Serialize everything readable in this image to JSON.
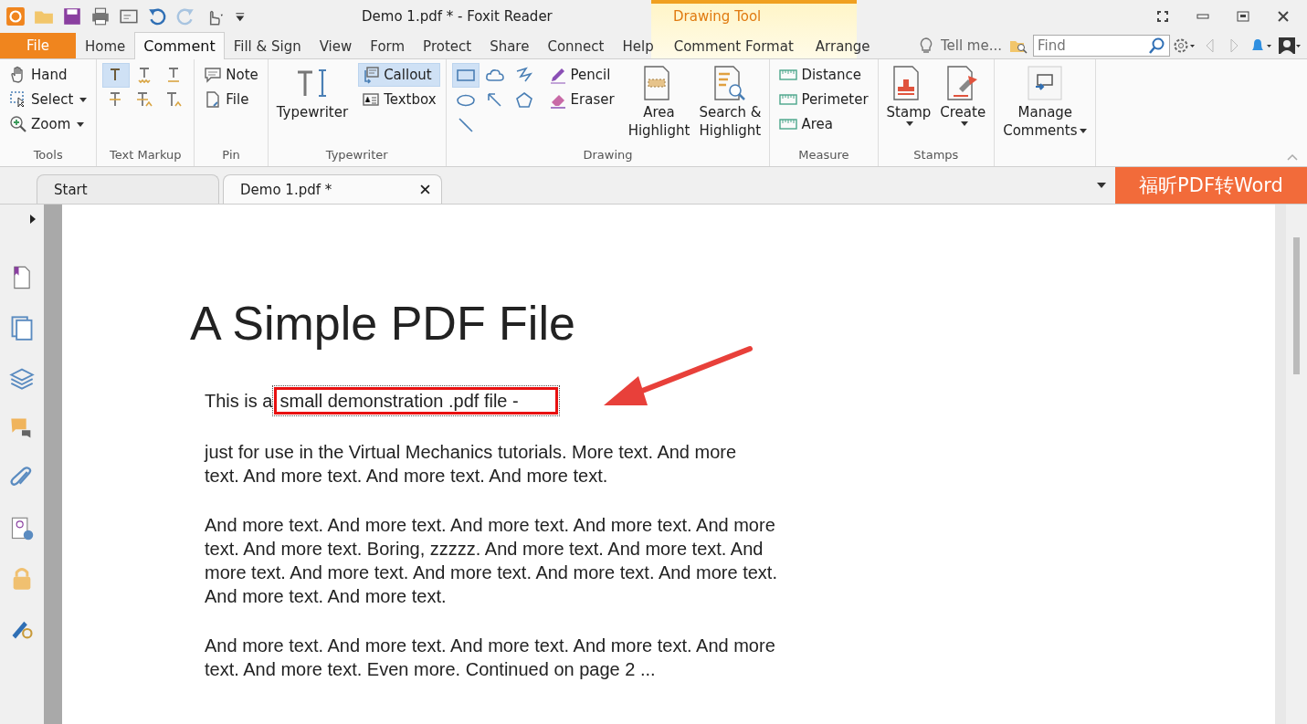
{
  "window": {
    "title": "Demo 1.pdf * - Foxit Reader",
    "context_tab": "Drawing Tool"
  },
  "menu_tabs": [
    {
      "label": "File",
      "kind": "file",
      "selected": false
    },
    {
      "label": "Home",
      "kind": "tab",
      "selected": false
    },
    {
      "label": "Comment",
      "kind": "tab",
      "selected": true
    },
    {
      "label": "Fill & Sign",
      "kind": "tab",
      "selected": false
    },
    {
      "label": "View",
      "kind": "tab",
      "selected": false
    },
    {
      "label": "Form",
      "kind": "tab",
      "selected": false
    },
    {
      "label": "Protect",
      "kind": "tab",
      "selected": false
    },
    {
      "label": "Share",
      "kind": "tab",
      "selected": false
    },
    {
      "label": "Connect",
      "kind": "tab",
      "selected": false
    },
    {
      "label": "Help",
      "kind": "tab",
      "selected": false
    },
    {
      "label": "Comment Format",
      "kind": "context",
      "selected": false
    },
    {
      "label": "Arrange",
      "kind": "context",
      "selected": false
    }
  ],
  "tell_me": "Tell me...",
  "search": {
    "placeholder": "Find"
  },
  "ribbon": [
    {
      "name": "Tools",
      "sections": [
        {
          "kind": "small",
          "items": [
            {
              "label": "Hand",
              "kind": "hand",
              "selected": false,
              "dropdown": false
            },
            {
              "label": "Select",
              "kind": "select",
              "selected": false,
              "dropdown": true
            },
            {
              "label": "Zoom",
              "kind": "zoom",
              "selected": false,
              "dropdown": true
            }
          ]
        }
      ]
    },
    {
      "name": "Text Markup",
      "sections": [
        {
          "kind": "icons",
          "items": [
            {
              "kind": "t-highlight",
              "selected": true
            },
            {
              "kind": "t-squiggly",
              "selected": false
            },
            {
              "kind": "t-underline",
              "selected": false
            },
            {
              "kind": "t-strike",
              "selected": false
            },
            {
              "kind": "t-replace",
              "selected": false
            },
            {
              "kind": "t-insert",
              "selected": false
            }
          ]
        }
      ]
    },
    {
      "name": "Pin",
      "sections": [
        {
          "kind": "small",
          "items": [
            {
              "label": "Note",
              "kind": "note",
              "selected": false,
              "dropdown": false
            },
            {
              "label": "File",
              "kind": "file",
              "selected": false,
              "dropdown": false
            }
          ]
        }
      ]
    },
    {
      "name": "Typewriter",
      "sections": [
        {
          "kind": "large",
          "items": [
            {
              "label": "Typewriter",
              "kind": "typewriter",
              "dropdown": false
            }
          ]
        },
        {
          "kind": "small",
          "items": [
            {
              "label": "Callout",
              "kind": "callout",
              "selected": true,
              "dropdown": false
            },
            {
              "label": "Textbox",
              "kind": "textbox",
              "selected": false,
              "dropdown": false
            }
          ]
        }
      ]
    },
    {
      "name": "Drawing",
      "sections": [
        {
          "kind": "icons",
          "items": [
            {
              "kind": "rectangle",
              "selected": true
            },
            {
              "kind": "cloud",
              "selected": false
            },
            {
              "kind": "polyline",
              "selected": false
            },
            {
              "kind": "oval",
              "selected": false
            },
            {
              "kind": "arrow",
              "selected": false
            },
            {
              "kind": "polygon",
              "selected": false
            },
            {
              "kind": "line",
              "selected": false
            }
          ]
        },
        {
          "kind": "small",
          "items": [
            {
              "label": "Pencil",
              "kind": "pencil",
              "selected": false,
              "dropdown": false
            },
            {
              "label": "Eraser",
              "kind": "eraser",
              "selected": false,
              "dropdown": false
            }
          ]
        },
        {
          "kind": "large",
          "items": [
            {
              "label": "Area\nHighlight",
              "kind": "area-highlight",
              "dropdown": false
            },
            {
              "label": "Search &\nHighlight",
              "kind": "search-highlight",
              "dropdown": false
            }
          ]
        }
      ]
    },
    {
      "name": "Measure",
      "sections": [
        {
          "kind": "small",
          "items": [
            {
              "label": "Distance",
              "kind": "ruler",
              "selected": false,
              "dropdown": false
            },
            {
              "label": "Perimeter",
              "kind": "ruler",
              "selected": false,
              "dropdown": false
            },
            {
              "label": "Area",
              "kind": "ruler",
              "selected": false,
              "dropdown": false
            }
          ]
        }
      ]
    },
    {
      "name": "Stamps",
      "sections": [
        {
          "kind": "large",
          "items": [
            {
              "label": "Stamp",
              "kind": "stamp",
              "dropdown": true
            },
            {
              "label": "Create",
              "kind": "stamp-create",
              "dropdown": true
            }
          ]
        }
      ]
    },
    {
      "sections": [
        {
          "kind": "large",
          "items": [
            {
              "label": "Manage\nComments",
              "kind": "manage",
              "dropdown": true
            }
          ]
        }
      ]
    }
  ],
  "doc_tabs": [
    {
      "label": "Start",
      "selected": false,
      "closable": false
    },
    {
      "label": "Demo 1.pdf *",
      "selected": true,
      "closable": true
    }
  ],
  "promo": "福昕PDF转Word",
  "document": {
    "title": "A Simple PDF File",
    "first_line": {
      "before": "This is a",
      "boxed": "small demonstration .pdf file -"
    },
    "paragraphs": [
      [
        "just for use in the Virtual Mechanics tutorials. More text. And more",
        "text. And more text. And more text. And more text."
      ],
      [
        "And more text. And more text. And more text. And more text. And more",
        "text. And more text. Boring, zzzzz. And more text. And more text. And",
        "more text. And more text. And more text. And more text. And more text.",
        "And more text. And more text."
      ],
      [
        "And more text. And more text. And more text. And more text. And more",
        "text. And more text. Even more. Continued on page 2 ..."
      ]
    ]
  }
}
